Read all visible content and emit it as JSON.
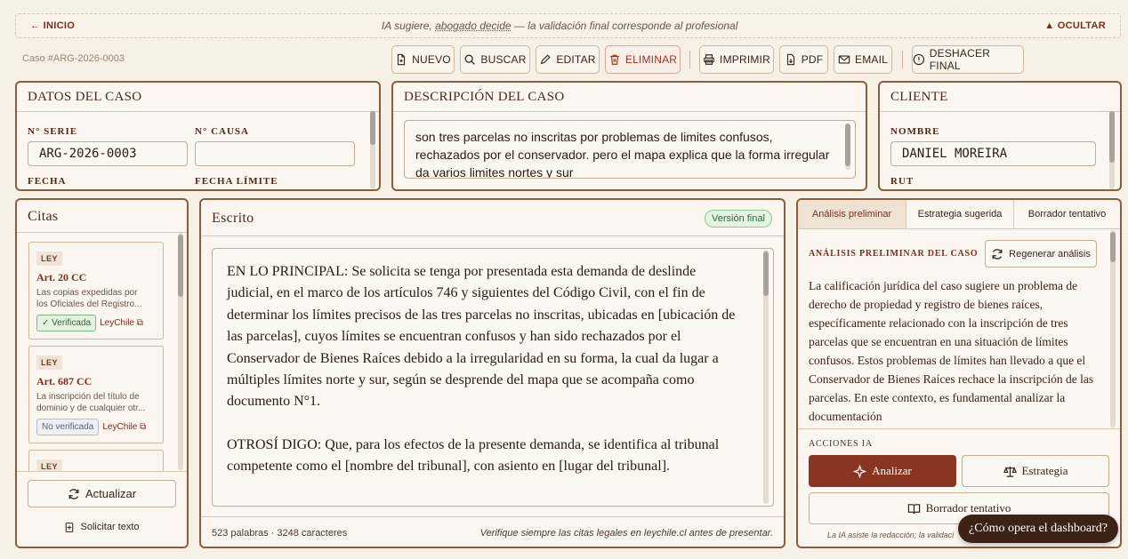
{
  "banner": {
    "home": "← INICIO",
    "msg_prefix": "IA sugiere,",
    "msg_link": "abogado decide",
    "msg_suffix": "— la validación final corresponde al profesional",
    "hide": "▲ OCULTAR"
  },
  "case_id": "Caso #ARG-2026-0003",
  "toolbar": {
    "new": "NUEVO",
    "search": "BUSCAR",
    "edit": "EDITAR",
    "delete": "ELIMINAR",
    "print": "IMPRIMIR",
    "pdf": "PDF",
    "email": "EMAIL",
    "undo_final": "DESHACER FINAL"
  },
  "case_data": {
    "title": "DATOS DEL CASO",
    "serie_label": "N° SERIE",
    "serie_value": "ARG-2026-0003",
    "causa_label": "N° CAUSA",
    "causa_value": "",
    "fecha_label": "FECHA",
    "fecha_limite_label": "FECHA LÍMITE"
  },
  "description": {
    "title": "DESCRIPCIÓN DEL CASO",
    "text": "son tres parcelas no inscritas por problemas de limites confusos, rechazados por el conservador. pero el mapa explica que la forma irregular da varios limites nortes y sur"
  },
  "client": {
    "title": "CLIENTE",
    "name_label": "NOMBRE",
    "name_value": "DANIEL MOREIRA",
    "rut_label": "RUT"
  },
  "citations": {
    "title": "Citas",
    "items": [
      {
        "tag": "LEY",
        "title": "Art. 20 CC",
        "desc1": "Las copias expedidas por",
        "desc2": "los Oficiales del Registro...",
        "status": "✓ Verificada",
        "link": "LeyChile"
      },
      {
        "tag": "LEY",
        "title": "Art. 687 CC",
        "desc1": "La inscripción del título de",
        "desc2": "dominio y de cualquier otr...",
        "status": "No verificada",
        "link": "LeyChile"
      },
      {
        "tag": "LEY"
      }
    ],
    "refresh": "Actualizar",
    "request": "Solicitar texto"
  },
  "escrito": {
    "title": "Escrito",
    "badge": "Versión final",
    "p1": "EN LO PRINCIPAL: Se solicita se tenga por presentada esta demanda de deslinde judicial, en el marco de los artículos 746 y siguientes del Código Civil, con el fin de determinar los límites precisos de las tres parcelas no inscritas, ubicadas en [ubicación de las parcelas], cuyos límites se encuentran confusos y han sido rechazados por el Conservador de Bienes Raíces debido a la irregularidad en su forma, la cual da lugar a múltiples límites norte y sur, según se desprende del mapa que se acompaña como documento N°1.",
    "p2": "OTROSÍ DIGO: Que, para los efectos de la presente demanda, se identifica al tribunal competente como el [nombre del tribunal], con asiento en [lugar del tribunal].",
    "stats": "523 palabras · 3248 caracteres",
    "warning": "Verifique siempre las citas legales en leychile.cl antes de presentar."
  },
  "analysis": {
    "tabs": [
      "Análisis preliminar",
      "Estrategia sugerida",
      "Borrador tentativo"
    ],
    "heading": "ANÁLISIS PRELIMINAR DEL CASO",
    "regen": "Regenerar análisis",
    "text": "La calificación jurídica del caso sugiere un problema de derecho de propiedad y registro de bienes raíces, específicamente relacionado con la inscripción de tres parcelas que se encuentran en una situación de límites confusos. Estos problemas de límites han llevado a que el Conservador de Bienes Raíces rechace la inscripción de las parcelas. En este contexto, es fundamental analizar la documentación",
    "actions_label": "ACCIONES IA",
    "analyze": "Analizar",
    "strategy": "Estrategia",
    "draft": "Borrador tentativo",
    "footnote": "La IA asiste la redacción; la validaci"
  },
  "help": "¿Cómo opera el dashboard?",
  "colors": {
    "accent": "#8a3520",
    "border": "#8d5b3e",
    "background": "#f6f0e6"
  }
}
